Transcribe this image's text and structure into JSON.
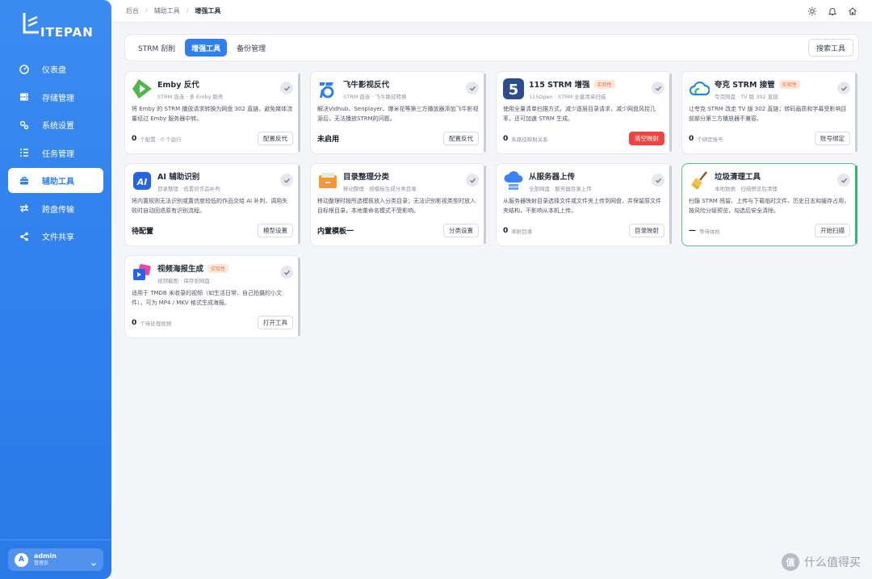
{
  "brand": {
    "logo_text": "ITEPAN"
  },
  "sidebar": {
    "items": [
      {
        "label": "仪表盘",
        "icon": "dashboard-icon"
      },
      {
        "label": "存储管理",
        "icon": "storage-icon"
      },
      {
        "label": "系统设置",
        "icon": "settings-icon"
      },
      {
        "label": "任务管理",
        "icon": "tasks-icon"
      },
      {
        "label": "辅助工具",
        "icon": "toolbox-icon",
        "active": true
      },
      {
        "label": "跨盘传输",
        "icon": "transfer-icon"
      },
      {
        "label": "文件共享",
        "icon": "share-icon"
      }
    ],
    "user": {
      "initial": "A",
      "name": "admin",
      "role": "管理员"
    }
  },
  "header": {
    "breadcrumb": [
      "后台",
      "辅助工具",
      "增强工具"
    ]
  },
  "tabs": {
    "items": [
      {
        "label": "STRM 刮削"
      },
      {
        "label": "增强工具",
        "active": true
      },
      {
        "label": "备份管理"
      }
    ],
    "search_label": "搜索工具"
  },
  "cards": [
    {
      "title": "Emby 反代",
      "badge": "",
      "subtitle": "STRM 直连 · 多 Emby 服务",
      "desc": "将 Emby 的 STRM 播放请求转换为网盘 302 直链，避免媒体流量经过 Emby 服务器中转。",
      "count": "0",
      "count_label": "个配置 · 0 个运行",
      "footer_text": "",
      "button": "配置反代",
      "icon": "emby-icon"
    },
    {
      "title": "飞牛影视反代",
      "badge": "",
      "subtitle": "STRM 直连 · 飞牛路径转换",
      "desc": "解决Vidhub、Senplayer、爆米花等第三方播放器添加飞牛影视源后，无法播放STRM的问题。",
      "count": "",
      "count_label": "",
      "footer_text": "未启用",
      "button": "配置反代",
      "icon": "feiniu-icon"
    },
    {
      "title": "115 STRM 增强",
      "badge": "实验性",
      "subtitle": "115Open · STRM 全量清单扫描",
      "desc": "使用全量清单扫描方式，减少逐层目录请求，减少网盘风控几率，还可加速 STRM 生成。",
      "count": "0",
      "count_label": "条路径映射关系",
      "footer_text": "",
      "button": "清空映射",
      "button_danger": true,
      "icon": "115-icon"
    },
    {
      "title": "夸克 STRM 接管",
      "badge": "实验性",
      "subtitle": "夸克网盘 · TV 版 302 直链",
      "desc": "让夸克 STRM 改走 TV 版 302 直链；转码画质和字幕受影响目前部分第三方播放器不兼容。",
      "count": "0",
      "count_label": "个绑定账号",
      "footer_text": "",
      "button": "账号绑定",
      "icon": "quark-icon"
    },
    {
      "title": "AI 辅助识别",
      "badge": "",
      "subtitle": "目录整理 · 低置信作品补判",
      "desc": "将内置规则无法识别或置信度较低的作品交给 AI 补判，调用失败时自动回退原有识别流程。",
      "count": "",
      "count_label": "",
      "footer_text": "待配置",
      "button": "模型设置",
      "icon": "ai-icon"
    },
    {
      "title": "目录整理分类",
      "badge": "",
      "subtitle": "移动整理 · 按模板生成分类目录",
      "desc": "移动整理时按所选模板放入分类目录；无法识别影视类型时放入目标根目录，本地重命名模式不受影响。",
      "count": "",
      "count_label": "",
      "footer_text": "内置模板一",
      "button": "分类设置",
      "icon": "folder-icon"
    },
    {
      "title": "从服务器上传",
      "badge": "",
      "subtitle": "全部网盘 · 服务器目录上传",
      "desc": "从服务器映射目录选择文件或文件夹上传到网盘，并保留原文件夹结构，不影响从本机上传。",
      "count": "0",
      "count_label": "映射目录",
      "footer_text": "",
      "button": "目录映射",
      "icon": "cloud-upload-icon"
    },
    {
      "title": "垃圾清理工具",
      "badge": "",
      "subtitle": "本地数据 · 扫描预览后清理",
      "desc": "扫描 STRM 残留、上传与下载临时文件、历史日志和缓存占用，按风险分级预览，勾选后安全清除。",
      "count": "—",
      "count_label": "等待体检",
      "footer_text": "",
      "button": "开始扫描",
      "icon": "broom-icon",
      "highlight": true
    },
    {
      "title": "视频海报生成",
      "badge": "实验性",
      "subtitle": "视频截图 · 保存到网盘",
      "desc": "适用于 TMDB 未收录的视频（如生活日常、自己拍摄的小文件），可为 MP4 / MKV 格式生成海报。",
      "count": "0",
      "count_label": "个待处理视频",
      "footer_text": "",
      "button": "打开工具",
      "icon": "poster-icon"
    }
  ],
  "watermark": {
    "circle": "值",
    "text": "什么值得买"
  },
  "colors": {
    "accent": "#2f7fee",
    "danger": "#ef4444",
    "badge_text": "#e8743b",
    "success": "#35b36f"
  }
}
